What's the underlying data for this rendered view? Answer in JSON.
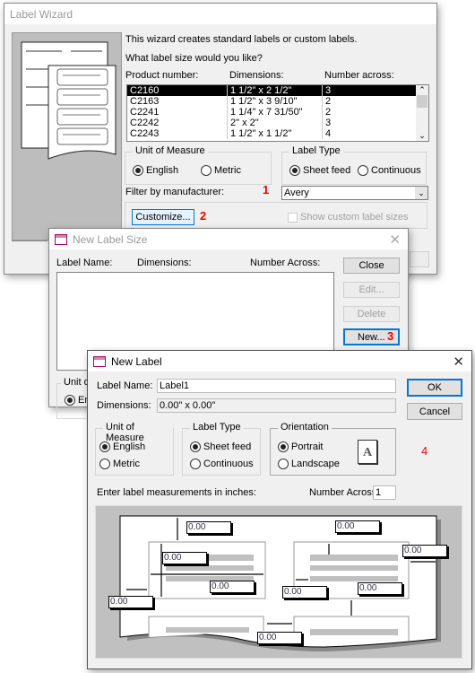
{
  "wizard": {
    "title": "Label Wizard",
    "intro": "This wizard creates standard labels or custom labels.",
    "question": "What label size would you like?",
    "columns": [
      "Product number:",
      "Dimensions:",
      "Number across:"
    ],
    "rows": [
      [
        "C2160",
        "1 1/2\" x 2 1/2\"",
        "3"
      ],
      [
        "C2163",
        "1 1/2\" x 3 9/10\"",
        "2"
      ],
      [
        "C2241",
        "1 1/4\" x 7 31/50\"",
        "2"
      ],
      [
        "C2242",
        "2\" x 2\"",
        "3"
      ],
      [
        "C2243",
        "1 1/2\" x 1 1/2\"",
        "4"
      ]
    ],
    "unit_group": "Unit of Measure",
    "unit_english": "English",
    "unit_metric": "Metric",
    "unit_selected": "English",
    "type_group": "Label Type",
    "type_sheet": "Sheet feed",
    "type_continuous": "Continuous",
    "type_selected": "Sheet feed",
    "filter_label": "Filter by  manufacturer:",
    "filter_value": "Avery",
    "customize": "Customize...",
    "show_custom": "Show custom label sizes",
    "show_custom_checked": false
  },
  "new_label_size": {
    "title": "New Label Size",
    "columns": [
      "Label Name:",
      "Dimensions:",
      "Number Across:"
    ],
    "close": "Close",
    "edit": "Edit...",
    "delete": "Delete",
    "new": "New...",
    "unit_partial": "Unit of",
    "english_partial": "En"
  },
  "new_label": {
    "title": "New Label",
    "name_label": "Label Name:",
    "name_value": "Label1",
    "dim_label": "Dimensions:",
    "dim_value": "0.00\" x 0.00\"",
    "ok": "OK",
    "cancel": "Cancel",
    "unit_group": "Unit of Measure",
    "english": "English",
    "metric": "Metric",
    "type_group": "Label Type",
    "sheet": "Sheet feed",
    "continuous": "Continuous",
    "orient_group": "Orientation",
    "portrait": "Portrait",
    "landscape": "Landscape",
    "orient_icon_letter": "A",
    "measure_label": "Enter label measurements in inches:",
    "across_label": "Number Across:",
    "across_value": "1",
    "measurements": [
      "0.00",
      "0.00",
      "0.00",
      "0.00",
      "0.00",
      "0.00",
      "0.00",
      "0.00",
      "0.00"
    ]
  },
  "annotations": [
    "1",
    "2",
    "3",
    "4"
  ],
  "colors": {
    "annotation": "#ee0000",
    "selection": "#000000",
    "focus": "#0078d7"
  }
}
